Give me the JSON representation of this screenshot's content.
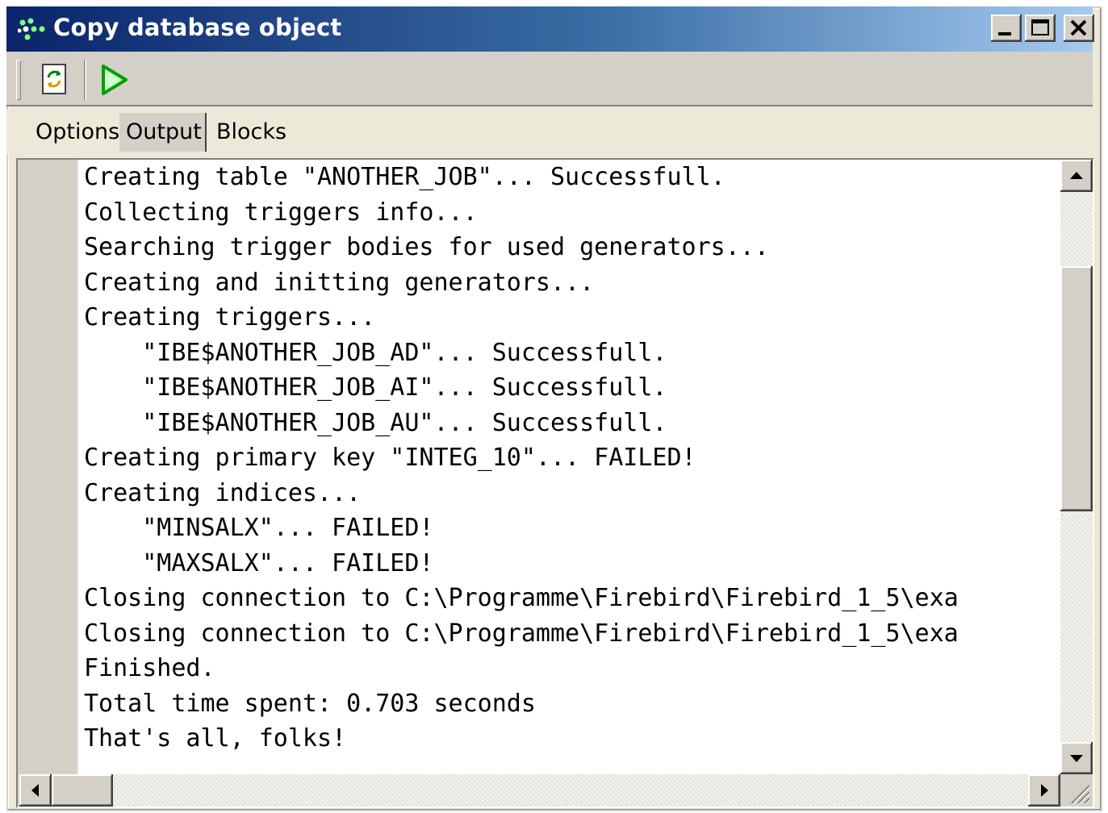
{
  "window": {
    "title": "Copy database object",
    "title_bar_colors": [
      "#0a246a",
      "#a6caf0"
    ]
  },
  "toolbar": {
    "items": [
      {
        "icon": "refresh-icon"
      },
      {
        "icon": "run-icon",
        "color": "#00a000"
      }
    ]
  },
  "tabs": [
    {
      "label": "Options"
    },
    {
      "label": "Output",
      "selected": true
    },
    {
      "label": "Blocks"
    }
  ],
  "output": {
    "lines": [
      "Creating table \"ANOTHER_JOB\"... Successfull.",
      "Collecting triggers info...",
      "Searching trigger bodies for used generators...",
      "Creating and initting generators...",
      "Creating triggers...",
      "    \"IBE$ANOTHER_JOB_AD\"... Successfull.",
      "    \"IBE$ANOTHER_JOB_AI\"... Successfull.",
      "    \"IBE$ANOTHER_JOB_AU\"... Successfull.",
      "Creating primary key \"INTEG_10\"... FAILED!",
      "Creating indices...",
      "    \"MINSALX\"... FAILED!",
      "    \"MAXSALX\"... FAILED!",
      "Closing connection to C:\\Programme\\Firebird\\Firebird_1_5\\exa",
      "Closing connection to C:\\Programme\\Firebird\\Firebird_1_5\\exa",
      "Finished.",
      "Total time spent: 0.703 seconds",
      "That's all, folks!"
    ]
  }
}
